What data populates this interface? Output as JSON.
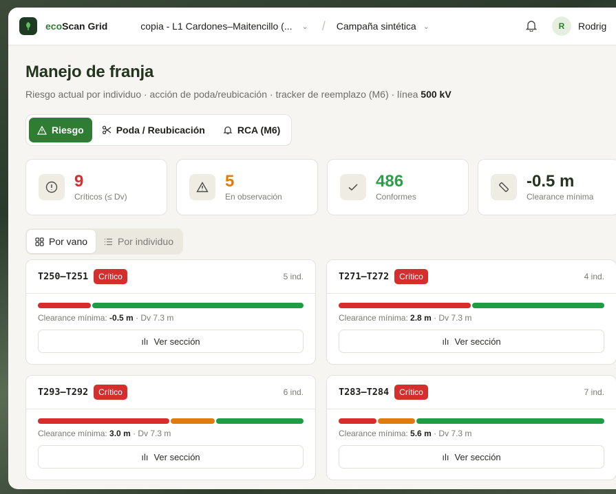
{
  "header": {
    "brand_eco": "eco",
    "brand_rest": "Scan Grid",
    "project": "copia - L1 Cardones–Maitencillo (...",
    "separator": "/",
    "campaign": "Campaña sintética",
    "avatar_initial": "R",
    "user": "Rodrig"
  },
  "page": {
    "title": "Manejo de franja",
    "subtitle": "Riesgo actual por individuo · acción de poda/reubicación · tracker de reemplazo (M6) · línea ",
    "subtitle_strong": "500 kV"
  },
  "tabs": [
    {
      "label": "Riesgo",
      "icon": "warning-icon"
    },
    {
      "label": "Poda / Reubicación",
      "icon": "scissors-icon"
    },
    {
      "label": "RCA (M6)",
      "icon": "bell-icon"
    }
  ],
  "stats": [
    {
      "value": "9",
      "label": "Críticos (≤ Dv)",
      "color": "#d32f2f",
      "icon": "alert-circle-icon"
    },
    {
      "value": "5",
      "label": "En observación",
      "color": "#e07c0d",
      "icon": "warning-icon"
    },
    {
      "value": "486",
      "label": "Conformes",
      "color": "#2e9e4a",
      "icon": "check-icon"
    },
    {
      "value": "-0.5 m",
      "label": "Clearance mínima",
      "color": "#24351f",
      "icon": "ruler-icon"
    }
  ],
  "view_toggle": [
    {
      "label": "Por vano",
      "icon": "grid-icon"
    },
    {
      "label": "Por individuo",
      "icon": "list-icon"
    }
  ],
  "colors": {
    "red": "#d92d2d",
    "orange": "#e07c0d",
    "green": "#1f9d45"
  },
  "spans": [
    {
      "title": "T250–T251",
      "badge": "Crítico",
      "count": "5 ind.",
      "clear_label": "Clearance mínima: ",
      "clear_value": "-0.5 m",
      "clear_suffix": " · Dv 7.3 m",
      "button": "Ver sección",
      "bar": {
        "red": 0.2,
        "orange": 0,
        "green": 0.8
      }
    },
    {
      "title": "T271–T272",
      "badge": "Crítico",
      "count": "4 ind.",
      "clear_label": "Clearance mínima: ",
      "clear_value": "2.8 m",
      "clear_suffix": " · Dv 7.3 m",
      "button": "Ver sección",
      "bar": {
        "red": 0.5,
        "orange": 0,
        "green": 0.5
      }
    },
    {
      "title": "T293–T292",
      "badge": "Crítico",
      "count": "6 ind.",
      "clear_label": "Clearance mínima: ",
      "clear_value": "3.0 m",
      "clear_suffix": " · Dv 7.3 m",
      "button": "Ver sección",
      "bar": {
        "red": 0.5,
        "orange": 0.167,
        "green": 0.333
      }
    },
    {
      "title": "T283–T284",
      "badge": "Crítico",
      "count": "7 ind.",
      "clear_label": "Clearance mínima: ",
      "clear_value": "5.6 m",
      "clear_suffix": " · Dv 7.3 m",
      "button": "Ver sección",
      "bar": {
        "red": 0.143,
        "orange": 0.143,
        "green": 0.714
      }
    }
  ]
}
